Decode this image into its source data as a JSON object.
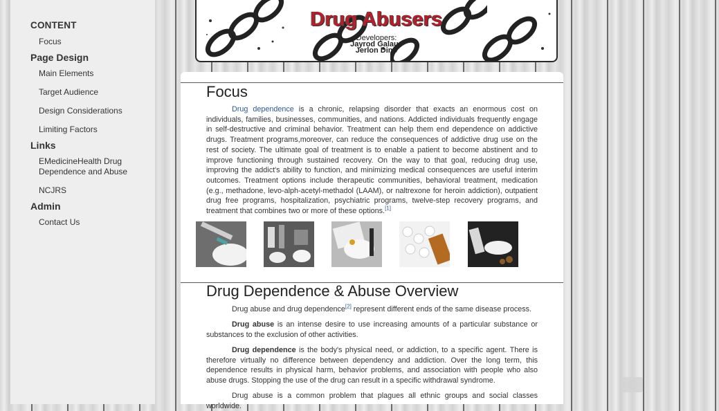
{
  "sidebar": {
    "content_heading": "CONTENT",
    "focus": "Focus",
    "page_design_heading": "Page Design",
    "main_elements": "Main Elements",
    "target_audience": "Target Audience",
    "design_considerations": "Design Considerations",
    "limiting_factors": "Limiting Factors",
    "links_heading": "Links",
    "emedicine_link": "EMedicineHealth Drug Dependence and Abuse",
    "ncjrs_link": "NCJRS",
    "admin_heading": "Admin",
    "contact_us": "Contact Us"
  },
  "banner": {
    "title": "Drug Abusers",
    "developers_label": "Developers:",
    "developer_1": "Jayrod Galaus",
    "developer_2": "Jerlon Dino"
  },
  "focus": {
    "heading": "Focus",
    "link_text": "Drug dependence",
    "body": " is a chronic, relapsing disorder that exacts an enormous cost on individuals, families, businesses, communities, and nations. Addicted individuals frequently engage in self-destructive and criminal behavior. Treatment can help them end dependence on addictive drugs. Treatment programs,moreover, can reduce the consequences of addictive drug use on the rest of society. The ultimate goal of treatment is to enable a patient to become abstinent and to improve functioning through sustained recovery. On the way to that goal, reducing drug use, improving the addict's ability to function, and minimizing medical consequences are useful interim outcomes. Treatment options include therapeutic communities, behavioral treatment, medication (e.g., methadone, levo-alph-acetyl-methadol (LAAM), or naltrexone for heroin addiction), outpatient drug free programs, hospitalization, psychiatric programs, twelve-step recovery programs, and treatment that combines two or more of these options.",
    "footnote": "[1]"
  },
  "overview": {
    "heading": "Drug Dependence & Abuse Overview",
    "p1_text": "Drug abuse and drug dependence",
    "p1_footnote": "[2]",
    "p1_rest": " represent different ends of the same disease process.",
    "p2_bold": "Drug abuse",
    "p2_text": " is an intense desire to use increasing amounts of a particular substance or substances to the exclusion of other activities.",
    "p3_bold": "Drug dependence",
    "p3_text": " is the body's physical need, or addiction, to a specific agent. There is therefore virtually no difference between dependency and addiction. Over the long term, this dependence results in physical harm, behavior problems, and association with people who also abuse drugs. Stopping the use of the drug can result in a specific withdrawal syndrome.",
    "p4_text": "Drug abuse is a common problem that plagues all ethnic groups and social classes worldwide."
  },
  "thumbnails": [
    {
      "icon": "syringe-image"
    },
    {
      "icon": "drug-paraphernalia-image"
    },
    {
      "icon": "powder-drugs-image"
    },
    {
      "icon": "pills-image"
    },
    {
      "icon": "drugs-table-image"
    }
  ]
}
